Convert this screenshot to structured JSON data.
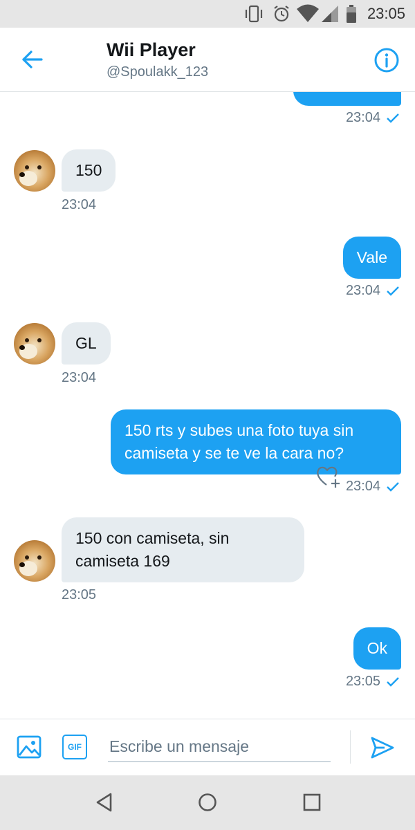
{
  "status_bar": {
    "time": "23:05",
    "icons": [
      "vibrate-icon",
      "alarm-icon",
      "wifi-icon",
      "signal-icon",
      "battery-icon"
    ]
  },
  "header": {
    "title": "Wii Player",
    "subtitle": "@Spoulakk_123",
    "back_icon": "arrow-left-icon",
    "info_icon": "info-icon"
  },
  "messages": [
    {
      "direction": "out",
      "text": "",
      "time": "23:04",
      "read": true
    },
    {
      "direction": "in",
      "text": "150",
      "time": "23:04"
    },
    {
      "direction": "out",
      "text": "Vale",
      "time": "23:04",
      "read": true
    },
    {
      "direction": "in",
      "text": "GL",
      "time": "23:04"
    },
    {
      "direction": "out",
      "text": "150 rts y subes una foto tuya sin camiseta y se te ve la cara no?",
      "time": "23:04",
      "read": true
    },
    {
      "direction": "in",
      "text": "150 con camiseta, sin camiseta 169",
      "time": "23:05"
    },
    {
      "direction": "out",
      "text": "Ok",
      "time": "23:05",
      "read": true
    }
  ],
  "composer": {
    "placeholder": "Escribe un mensaje",
    "gif_label": "GIF"
  },
  "colors": {
    "accent": "#1da1f2",
    "incoming_bubble": "#e6ecf0",
    "secondary_text": "#657786"
  }
}
